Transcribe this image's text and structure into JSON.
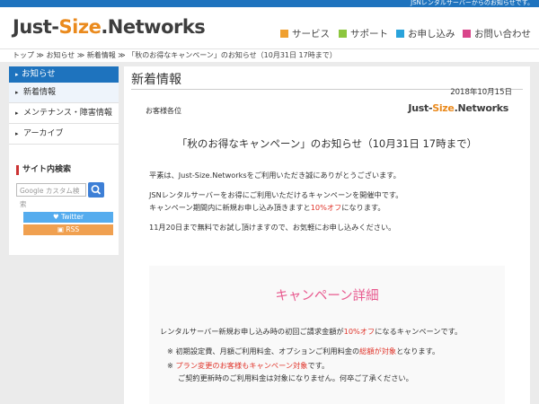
{
  "topstrip": {
    "text": "JSNレンタルサーバーからのお知らせです。"
  },
  "header": {
    "logo_a": "Just-",
    "logo_b": "Size",
    "logo_c": ".Networks",
    "nav": [
      {
        "label": "サービス",
        "color": "#f0a030"
      },
      {
        "label": "サポート",
        "color": "#8cc63e"
      },
      {
        "label": "お申し込み",
        "color": "#29a3db"
      },
      {
        "label": "お問い合わせ",
        "color": "#d9458a"
      }
    ]
  },
  "breadcrumb": "トップ ≫ お知らせ ≫ 新着情報 ≫ 「秋のお得なキャンペーン」のお知らせ（10月31日 17時まで）",
  "sidebar": {
    "header": "お知らせ",
    "items": [
      "新着情報",
      "メンテナンス・障害情報",
      "アーカイブ"
    ],
    "search_title": "サイト内検索",
    "search_placeholder": "Google カスタム検索",
    "twitter": "Twitter",
    "rss": "RSS"
  },
  "main": {
    "title": "新着情報",
    "date": "2018年10月15日",
    "dear": "お客様各位",
    "logo_a": "Just-",
    "logo_b": "Size",
    "logo_c": ".Networks",
    "notice_title": "「秋のお得なキャンペーン」のお知らせ（10月31日 17時まで）",
    "p1": "平素は、Just-Size.Networksをご利用いただき誠にありがとうございます。",
    "p2": "JSNレンタルサーバーをお得にご利用いただけるキャンペーンを開催中です。",
    "p3_a": "キャンペーン期間内に新規お申し込み頂きますと",
    "p3_red": "10%オフ",
    "p3_b": "になります。",
    "p4": "11月20日まで無料でお試し頂けますので、お気軽にお申し込みください。",
    "box_title": "キャンペーン詳細",
    "b1_a": "レンタルサーバー新規お申し込み時の初回ご請求金額が",
    "b1_red": "10%オフ",
    "b1_b": "になるキャンペーンです。",
    "b2_a": "※ 初期設定費、月額ご利用料金、オプションご利用料金の",
    "b2_red": "総額が対象",
    "b2_b": "となります。",
    "b3_mark": "※ ",
    "b3_red": "プラン変更のお客様もキャンペーン対象",
    "b3_b": "です。",
    "b4": "ご契約更新時のご利用料金は対象になりません。何卒ご了承ください。"
  }
}
